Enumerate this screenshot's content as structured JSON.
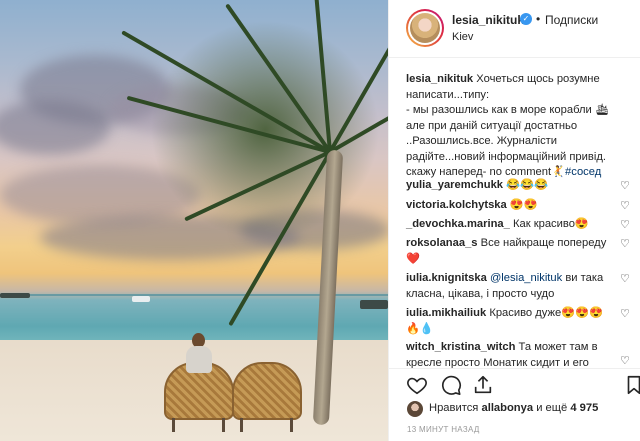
{
  "post": {
    "username": "lesia_nikituk",
    "dot": "•",
    "follow_label": "Подписки",
    "location": "Kiev",
    "caption_user": "lesia_nikituk",
    "caption_line1": "Хочеться щось розумне",
    "caption_line2": "написати...типу:",
    "caption_line3": "- мы разошлись как в море корабли 🛳",
    "caption_line4": "але при даній ситуації достатньо",
    "caption_line5": "..Разошлись.все. Журналісти",
    "caption_line6": "радійте...новий інформаційний привід.",
    "caption_line7": "скажу наперед- no comment🤾",
    "caption_tag": "#сосед"
  },
  "comments": [
    {
      "user": "yulia_yaremchukk",
      "text": "😂😂😂"
    },
    {
      "user": "victoria.kolchytska",
      "text": "😍😍"
    },
    {
      "user": "_devochka.marina_",
      "text": "Как красиво😍"
    },
    {
      "user": "roksolanaa_s",
      "text": "Все найкраще попереду",
      "text2": "❤️"
    },
    {
      "user": "iulia.knignitska",
      "mention": "@lesia_nikituk",
      "text": " ви така",
      "text2": "класна, цікава, і просто чудо"
    },
    {
      "user": "iulia.mikhailiuk",
      "text": "Красиво дуже😍😍😍",
      "text2": "🔥💧"
    },
    {
      "user": "witch_kristina_witch",
      "text": "Та может там в",
      "text2": "кресле просто Монатик сидит и его"
    }
  ],
  "icons": {
    "heart": "heart-icon",
    "comment": "comment-icon",
    "share": "share-icon",
    "save": "bookmark-icon"
  },
  "likes": {
    "prefix": "Нравится",
    "user": "allabonya",
    "suffix": "и ещё",
    "count": "4 975"
  },
  "time_ago": "13 МИНУТ НАЗАД"
}
